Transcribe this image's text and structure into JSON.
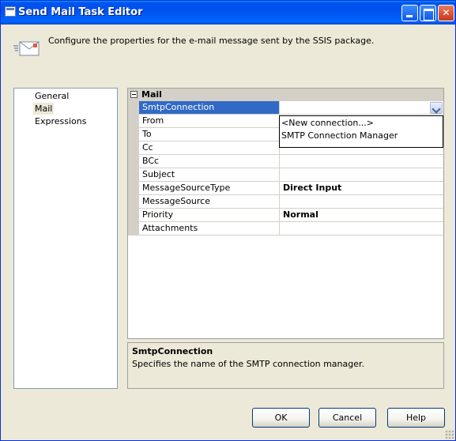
{
  "window": {
    "title": "Send Mail Task Editor"
  },
  "header": {
    "text": "Configure the properties for the e-mail message sent by the SSIS package."
  },
  "nav": {
    "items": [
      {
        "label": "General",
        "selected": false
      },
      {
        "label": "Mail",
        "selected": true
      },
      {
        "label": "Expressions",
        "selected": false
      }
    ]
  },
  "grid": {
    "category": "Mail",
    "properties": [
      {
        "name": "SmtpConnection",
        "value": ""
      },
      {
        "name": "From",
        "value": ""
      },
      {
        "name": "To",
        "value": ""
      },
      {
        "name": "Cc",
        "value": ""
      },
      {
        "name": "BCc",
        "value": ""
      },
      {
        "name": "Subject",
        "value": ""
      },
      {
        "name": "MessageSourceType",
        "value": "Direct Input"
      },
      {
        "name": "MessageSource",
        "value": ""
      },
      {
        "name": "Priority",
        "value": "Normal"
      },
      {
        "name": "Attachments",
        "value": ""
      }
    ],
    "dropdown_options": [
      "<New connection...>",
      "SMTP Connection Manager"
    ]
  },
  "description": {
    "title": "SmtpConnection",
    "text": "Specifies the name of the SMTP connection manager."
  },
  "buttons": {
    "ok": "OK",
    "cancel": "Cancel",
    "help": "Help"
  },
  "colors": {
    "title_bar": "#0054e3",
    "selection": "#316ac5",
    "dialog_bg": "#ece9d8"
  }
}
